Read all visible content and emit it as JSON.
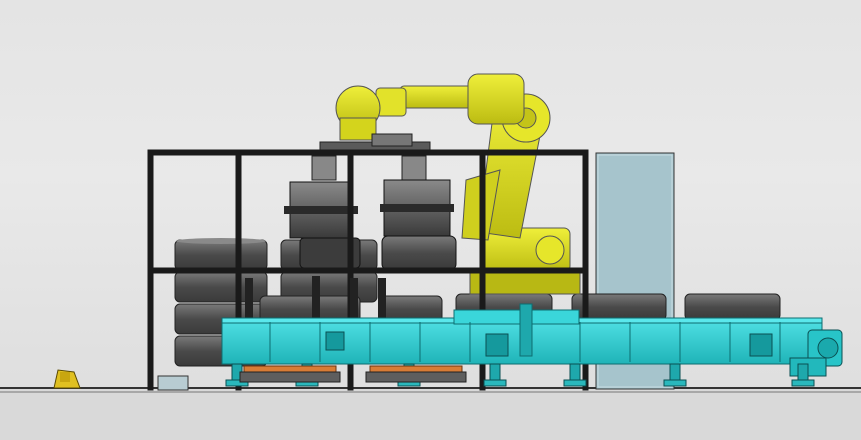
{
  "viewport": {
    "background_top": "#e4e4e4",
    "background_bottom": "#dcdcdc"
  },
  "scene": {
    "robot_color": "#d8d81c",
    "robot_shade": "#a8a80a",
    "conveyor_color": "#2ed0d4",
    "conveyor_shade": "#1a9ea2",
    "frame_color": "#1e1e1e",
    "tire_color": "#4a4a4a",
    "tire_highlight": "#6c6c6c",
    "panel_color": "#a6c8d2",
    "floor_color": "#cfcfcf",
    "warning_color": "#e0c020"
  }
}
